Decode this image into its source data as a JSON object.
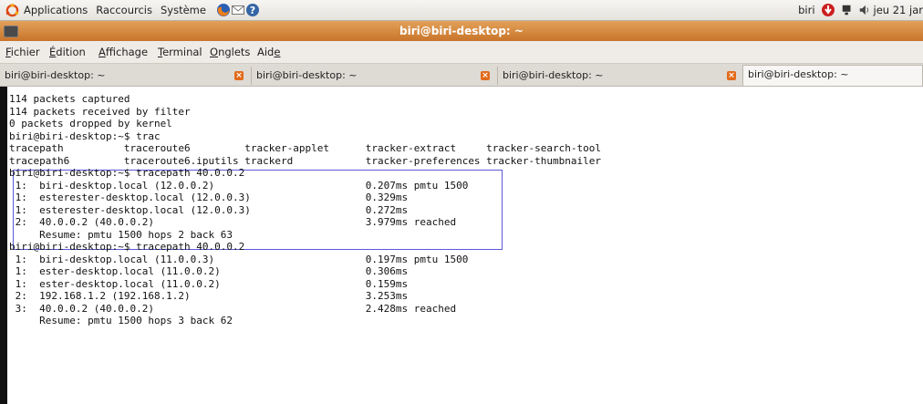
{
  "panel": {
    "menus": [
      "Applications",
      "Raccourcis",
      "Système"
    ],
    "user": "biri",
    "clock": "jeu 21 jar"
  },
  "window": {
    "title": "biri@biri-desktop: ~"
  },
  "menubar": [
    {
      "pre": "",
      "ul": "F",
      "post": "ichier"
    },
    {
      "pre": "",
      "ul": "É",
      "post": "dition"
    },
    {
      "pre": "",
      "ul": "A",
      "post": "ffichage"
    },
    {
      "pre": "",
      "ul": "T",
      "post": "erminal"
    },
    {
      "pre": "",
      "ul": "O",
      "post": "nglets"
    },
    {
      "pre": "Aid",
      "ul": "e",
      "post": ""
    }
  ],
  "tabs": [
    "biri@biri-desktop: ~",
    "biri@biri-desktop: ~",
    "biri@biri-desktop: ~",
    "biri@biri-desktop: ~"
  ],
  "terminal": {
    "lines": [
      "114 packets captured",
      "114 packets received by filter",
      "0 packets dropped by kernel",
      "biri@biri-desktop:~$ trac",
      "tracepath          traceroute6         tracker-applet      tracker-extract     tracker-search-tool",
      "tracepath6         traceroute6.iputils trackerd            tracker-preferences tracker-thumbnailer",
      "biri@biri-desktop:~$ tracepath 40.0.0.2",
      " 1:  biri-desktop.local (12.0.0.2)                         0.207ms pmtu 1500",
      " 1:  esterester-desktop.local (12.0.0.3)                   0.329ms",
      " 1:  esterester-desktop.local (12.0.0.3)                   0.272ms",
      " 2:  40.0.0.2 (40.0.0.2)                                   3.979ms reached",
      "     Resume: pmtu 1500 hops 2 back 63",
      "biri@biri-desktop:~$ tracepath 40.0.0.2",
      " 1:  biri-desktop.local (11.0.0.3)                         0.197ms pmtu 1500",
      " 1:  ester-desktop.local (11.0.0.2)                        0.306ms",
      " 1:  ester-desktop.local (11.0.0.2)                        0.159ms",
      " 2:  192.168.1.2 (192.168.1.2)                             3.253ms",
      " 3:  40.0.0.2 (40.0.0.2)                                   2.428ms reached",
      "     Resume: pmtu 1500 hops 3 back 62"
    ]
  },
  "colors": {
    "titlebar": "#d8883d",
    "highlight_border": "#5a5ad8",
    "tab_close": "#e26b1c"
  }
}
